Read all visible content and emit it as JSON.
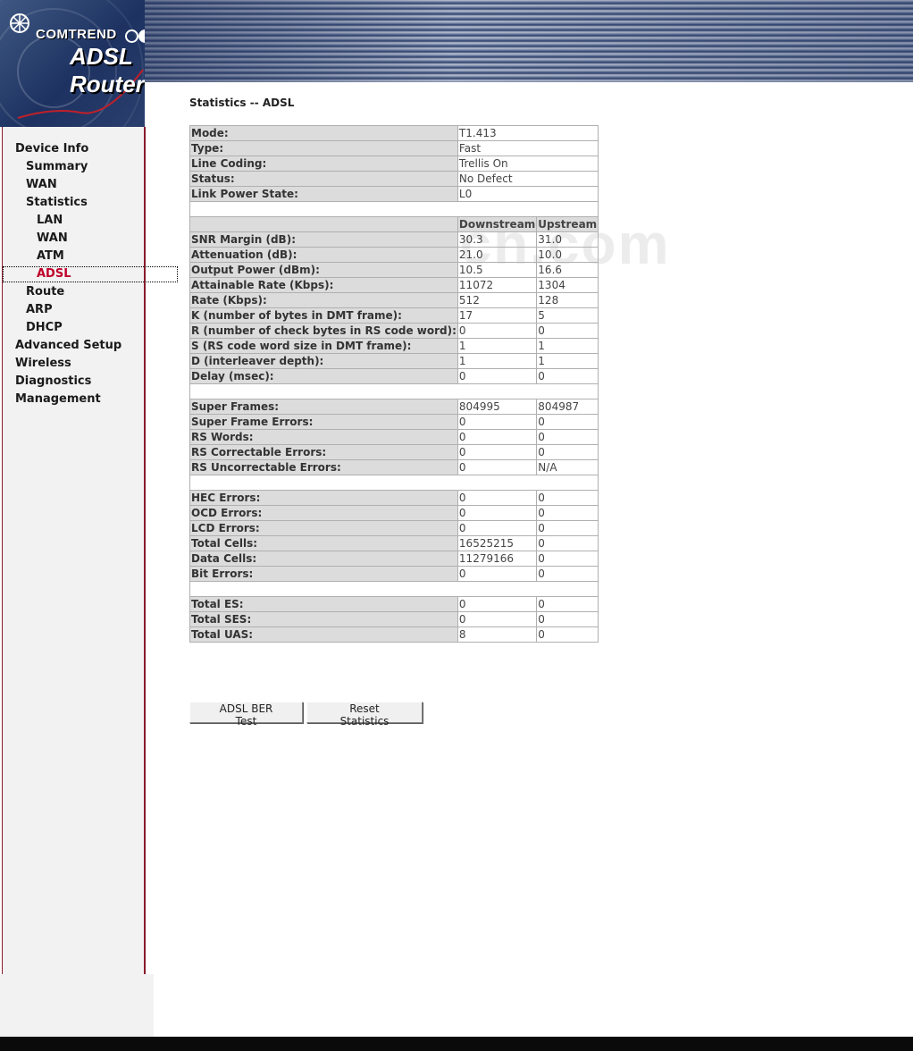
{
  "header": {
    "brand": "COMTREND",
    "product": "ADSL Router"
  },
  "sidebar": {
    "items": [
      {
        "label": "Device Info"
      },
      {
        "label": "Summary"
      },
      {
        "label": "WAN"
      },
      {
        "label": "Statistics"
      },
      {
        "label": "LAN"
      },
      {
        "label": "WAN"
      },
      {
        "label": "ATM"
      },
      {
        "label": "ADSL"
      },
      {
        "label": "Route"
      },
      {
        "label": "ARP"
      },
      {
        "label": "DHCP"
      },
      {
        "label": "Advanced Setup"
      },
      {
        "label": "Wireless"
      },
      {
        "label": "Diagnostics"
      },
      {
        "label": "Management"
      }
    ],
    "active": "ADSL"
  },
  "main": {
    "title": "Statistics -- ADSL",
    "general": [
      {
        "label": "Mode:",
        "value": "T1.413"
      },
      {
        "label": "Type:",
        "value": "Fast"
      },
      {
        "label": "Line Coding:",
        "value": "Trellis On"
      },
      {
        "label": "Status:",
        "value": "No Defect"
      },
      {
        "label": "Link Power State:",
        "value": "L0"
      }
    ],
    "columns": {
      "down": "Downstream",
      "up": "Upstream"
    },
    "group1": [
      {
        "label": "SNR Margin (dB):",
        "down": "30.3",
        "up": "31.0"
      },
      {
        "label": "Attenuation (dB):",
        "down": "21.0",
        "up": "10.0"
      },
      {
        "label": "Output Power (dBm):",
        "down": "10.5",
        "up": "16.6"
      },
      {
        "label": "Attainable Rate (Kbps):",
        "down": "11072",
        "up": "1304"
      },
      {
        "label": "Rate (Kbps):",
        "down": "512",
        "up": "128"
      },
      {
        "label": "K (number of bytes in DMT frame):",
        "down": "17",
        "up": "5"
      },
      {
        "label": "R (number of check bytes in RS code word):",
        "down": "0",
        "up": "0"
      },
      {
        "label": "S (RS code word size in DMT frame):",
        "down": "1",
        "up": "1"
      },
      {
        "label": "D (interleaver depth):",
        "down": "1",
        "up": "1"
      },
      {
        "label": "Delay (msec):",
        "down": "0",
        "up": "0"
      }
    ],
    "group2": [
      {
        "label": "Super Frames:",
        "down": "804995",
        "up": "804987"
      },
      {
        "label": "Super Frame Errors:",
        "down": "0",
        "up": "0"
      },
      {
        "label": "RS Words:",
        "down": "0",
        "up": "0"
      },
      {
        "label": "RS Correctable Errors:",
        "down": "0",
        "up": "0"
      },
      {
        "label": "RS Uncorrectable Errors:",
        "down": "0",
        "up": "N/A"
      }
    ],
    "group3": [
      {
        "label": "HEC Errors:",
        "down": "0",
        "up": "0"
      },
      {
        "label": "OCD Errors:",
        "down": "0",
        "up": "0"
      },
      {
        "label": "LCD Errors:",
        "down": "0",
        "up": "0"
      },
      {
        "label": "Total Cells:",
        "down": "16525215",
        "up": "0"
      },
      {
        "label": "Data Cells:",
        "down": "11279166",
        "up": "0"
      },
      {
        "label": "Bit Errors:",
        "down": "0",
        "up": "0"
      }
    ],
    "group4": [
      {
        "label": "Total ES:",
        "down": "0",
        "up": "0"
      },
      {
        "label": "Total SES:",
        "down": "0",
        "up": "0"
      },
      {
        "label": "Total UAS:",
        "down": "8",
        "up": "0"
      }
    ],
    "buttons": {
      "ber_test": "ADSL BER Test",
      "reset": "Reset Statistics"
    }
  },
  "watermark": "DeWinTech.com",
  "colors": {
    "active_nav": "#c0002a",
    "sidebar_border": "#8b1a2b",
    "label_cell_bg": "#dcdcdc"
  }
}
